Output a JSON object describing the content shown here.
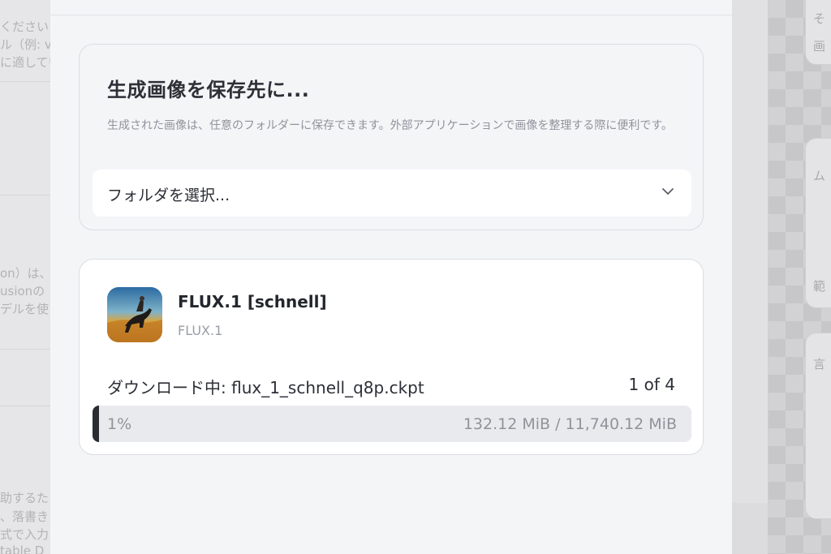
{
  "background_left": {
    "lines": [
      "ください",
      "ル（例: v",
      "に適してい",
      "on）は、",
      "usionの",
      "デルを使",
      "助するた",
      "、落書き",
      "式で入力",
      "table D"
    ]
  },
  "background_right": {
    "glyphs": [
      "そ",
      "画",
      "ム",
      "範",
      "言"
    ]
  },
  "save_section": {
    "title": "生成画像を保存先に...",
    "description": "生成された画像は、任意のフォルダーに保存できます。外部アプリケーションで画像を整理する際に便利です。",
    "folder_select": {
      "value": "フォルダを選択...",
      "icon": "chevron-down-icon"
    }
  },
  "download_section": {
    "model": {
      "name": "FLUX.1 [schnell]",
      "family": "FLUX.1",
      "icon": "model-thumbnail-horse-rider"
    },
    "status": "ダウンロード中: flux_1_schnell_q8p.ckpt",
    "file_count": "1 of 4",
    "progress": {
      "percent_label": "1%",
      "fraction": 0.011,
      "size_label": "132.12 MiB / 11,740.12 MiB"
    }
  },
  "colors": {
    "sheet_bg": "#f4f5f7",
    "card_border": "#dcdde2",
    "progress_fill": "#2a2c33",
    "progress_track": "#e9eaed",
    "muted_text": "#8f939b"
  }
}
